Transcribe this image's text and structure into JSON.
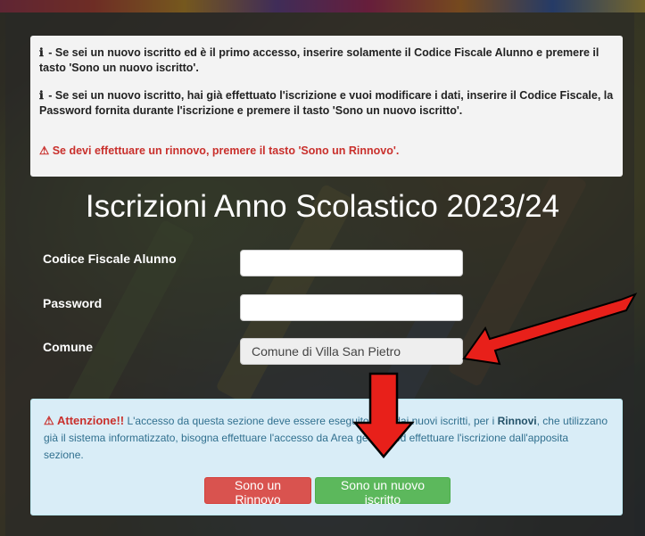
{
  "info": {
    "line1_icon": "ℹ",
    "line1": " - Se sei un nuovo iscritto ed è il primo accesso, inserire solamente il Codice Fiscale Alunno e premere il tasto 'Sono un nuovo iscritto'.",
    "line2_icon": "ℹ",
    "line2": " - Se sei un nuovo iscritto, hai già effettuato l'iscrizione e vuoi modificare i dati, inserire il Codice Fiscale, la Password fornita durante l'iscrizione e premere il tasto 'Sono un nuovo iscritto'.",
    "warning_icon": "⚠",
    "warning": " Se devi effettuare un rinnovo, premere il tasto 'Sono un Rinnovo'."
  },
  "title": "Iscrizioni Anno Scolastico 2023/24",
  "form": {
    "codice_fiscale_label": "Codice Fiscale Alunno",
    "codice_fiscale_value": "",
    "password_label": "Password",
    "password_value": "",
    "comune_label": "Comune",
    "comune_value": "Comune di Villa San Pietro"
  },
  "alert": {
    "icon": "⚠",
    "attention": "Attenzione!!",
    "text_part1": " L'accesso da questa sezione deve essere eseguito solo dai nuovi iscritti, per i ",
    "rinnovi": "Rinnovi",
    "text_part2": ", che utilizzano già il sistema informatizzato, bisogna effettuare l'accesso da Area genitori ed effettuare l'iscrizione dall'apposita sezione."
  },
  "buttons": {
    "rinnovo": "Sono un Rinnovo",
    "nuovo": "Sono un nuovo iscritto"
  },
  "colors": {
    "annotation_arrow": "#e8201a",
    "danger": "#d9534f",
    "success": "#5cb85c",
    "info_bg": "#d9edf7"
  }
}
